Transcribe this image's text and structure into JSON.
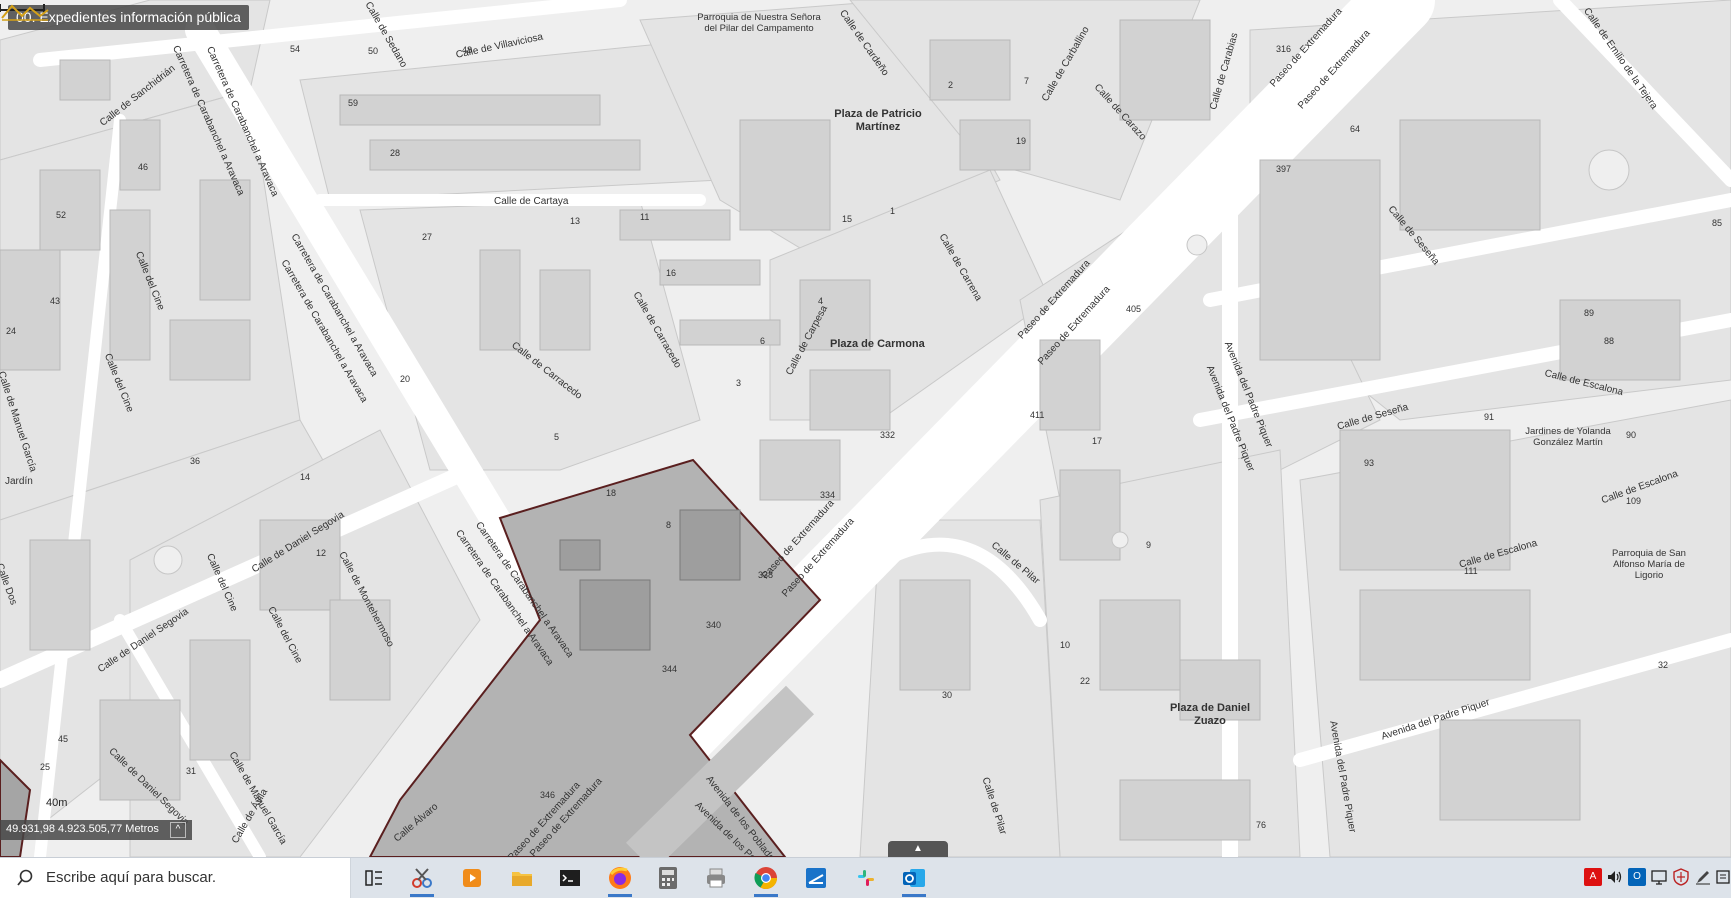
{
  "layer_title": "00. Expedientes información pública",
  "scale_label": "40m",
  "coordinates": "49.931,98 4.923.505,77 Metros",
  "coords_toggle": "^",
  "map_handle": "▲",
  "colors": {
    "selection_fill": "#b3b3b3",
    "selection_stroke": "#5a1f1f",
    "road": "#ffffff",
    "block": "#e6e6e6",
    "building": "#d0d0d0"
  },
  "places": [
    "Parroquia de Nuestra Señora del Pilar del Campamento",
    "Plaza de Patricio Martínez",
    "Plaza de Carmona",
    "Plaza de Daniel Zuazo",
    "Jardines de Yolanda González Martín",
    "Parroquia de San Alfonso María de Ligorio",
    "Jardín"
  ],
  "streets": [
    "Calle de Villaviciosa",
    "Calle de Sanchidrián",
    "Carretera de Carabanchel a Aravaca",
    "Calle de Cartaya",
    "Calle del Cine",
    "Calle de Manuel García",
    "Calle de Daniel Segovia",
    "Calle de Montehermoso",
    "Calle de Carracedo",
    "Calle de Carpesa",
    "Calle de Carrena",
    "Calle de Carazo",
    "Calle de Carabias",
    "Calle de Cardeño",
    "Calle de Carballino",
    "Paseo de Extremadura",
    "Avenida del Padre Piquer",
    "Calle de Seseña",
    "Calle de Escalona",
    "Calle de Emilio de la Tejera",
    "Calle de Pilar",
    "Avenida de los Poblados",
    "Calle Dos",
    "Calle de Sedano",
    "Calle de Ávila",
    "Calle Álvaro"
  ],
  "numbers": [
    "54",
    "50",
    "48",
    "59",
    "28",
    "46",
    "52",
    "43",
    "24",
    "20",
    "22",
    "13",
    "11",
    "16",
    "6",
    "3",
    "5",
    "18",
    "4",
    "1",
    "2",
    "7",
    "9",
    "10",
    "15",
    "32",
    "19",
    "334",
    "332",
    "338",
    "340",
    "344",
    "346",
    "405",
    "411",
    "397",
    "64",
    "85",
    "89",
    "88",
    "91",
    "93",
    "90",
    "109",
    "111",
    "17",
    "30",
    "27",
    "12",
    "45",
    "31",
    "36",
    "25",
    "8",
    "14",
    "316",
    "76"
  ],
  "taskbar": {
    "search_placeholder": "Escribe aquí para buscar.",
    "apps": [
      "task-view",
      "snipping-tool",
      "media-player",
      "file-explorer",
      "terminal",
      "firefox",
      "calculator",
      "printer",
      "chrome",
      "autocad",
      "slack",
      "outlook"
    ],
    "tray": [
      "acrobat-icon",
      "volume-icon",
      "outlook-tray-icon",
      "network-icon",
      "security-icon",
      "pen-icon",
      "notification-icon"
    ]
  }
}
